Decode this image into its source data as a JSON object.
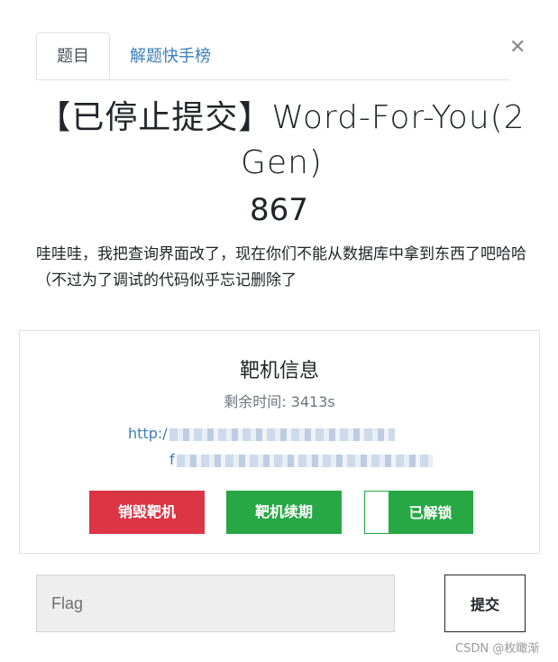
{
  "tabs": {
    "active": "题目",
    "other": "解题快手榜"
  },
  "close_icon": "close-icon",
  "challenge": {
    "title": "【已停止提交】Word-For-You(2 Gen)",
    "score": "867",
    "description": "哇哇哇，我把查询界面改了，现在你们不能从数据库中拿到东西了吧哈哈（不过为了调试的代码似乎忘记删除了"
  },
  "target_panel": {
    "title": "靶机信息",
    "remaining": "剩余时间: 3413s",
    "url_line1_prefix": "http:/",
    "url_line2_prefix": "f",
    "buttons": {
      "destroy": "销毁靶机",
      "renew": "靶机续期",
      "unlock": "已解锁"
    }
  },
  "flag": {
    "placeholder": "Flag",
    "submit": "提交"
  },
  "watermark": "CSDN @枚瞰渐",
  "colors": {
    "danger": "#dc3545",
    "success": "#28a745",
    "link": "#3b7eb9"
  }
}
